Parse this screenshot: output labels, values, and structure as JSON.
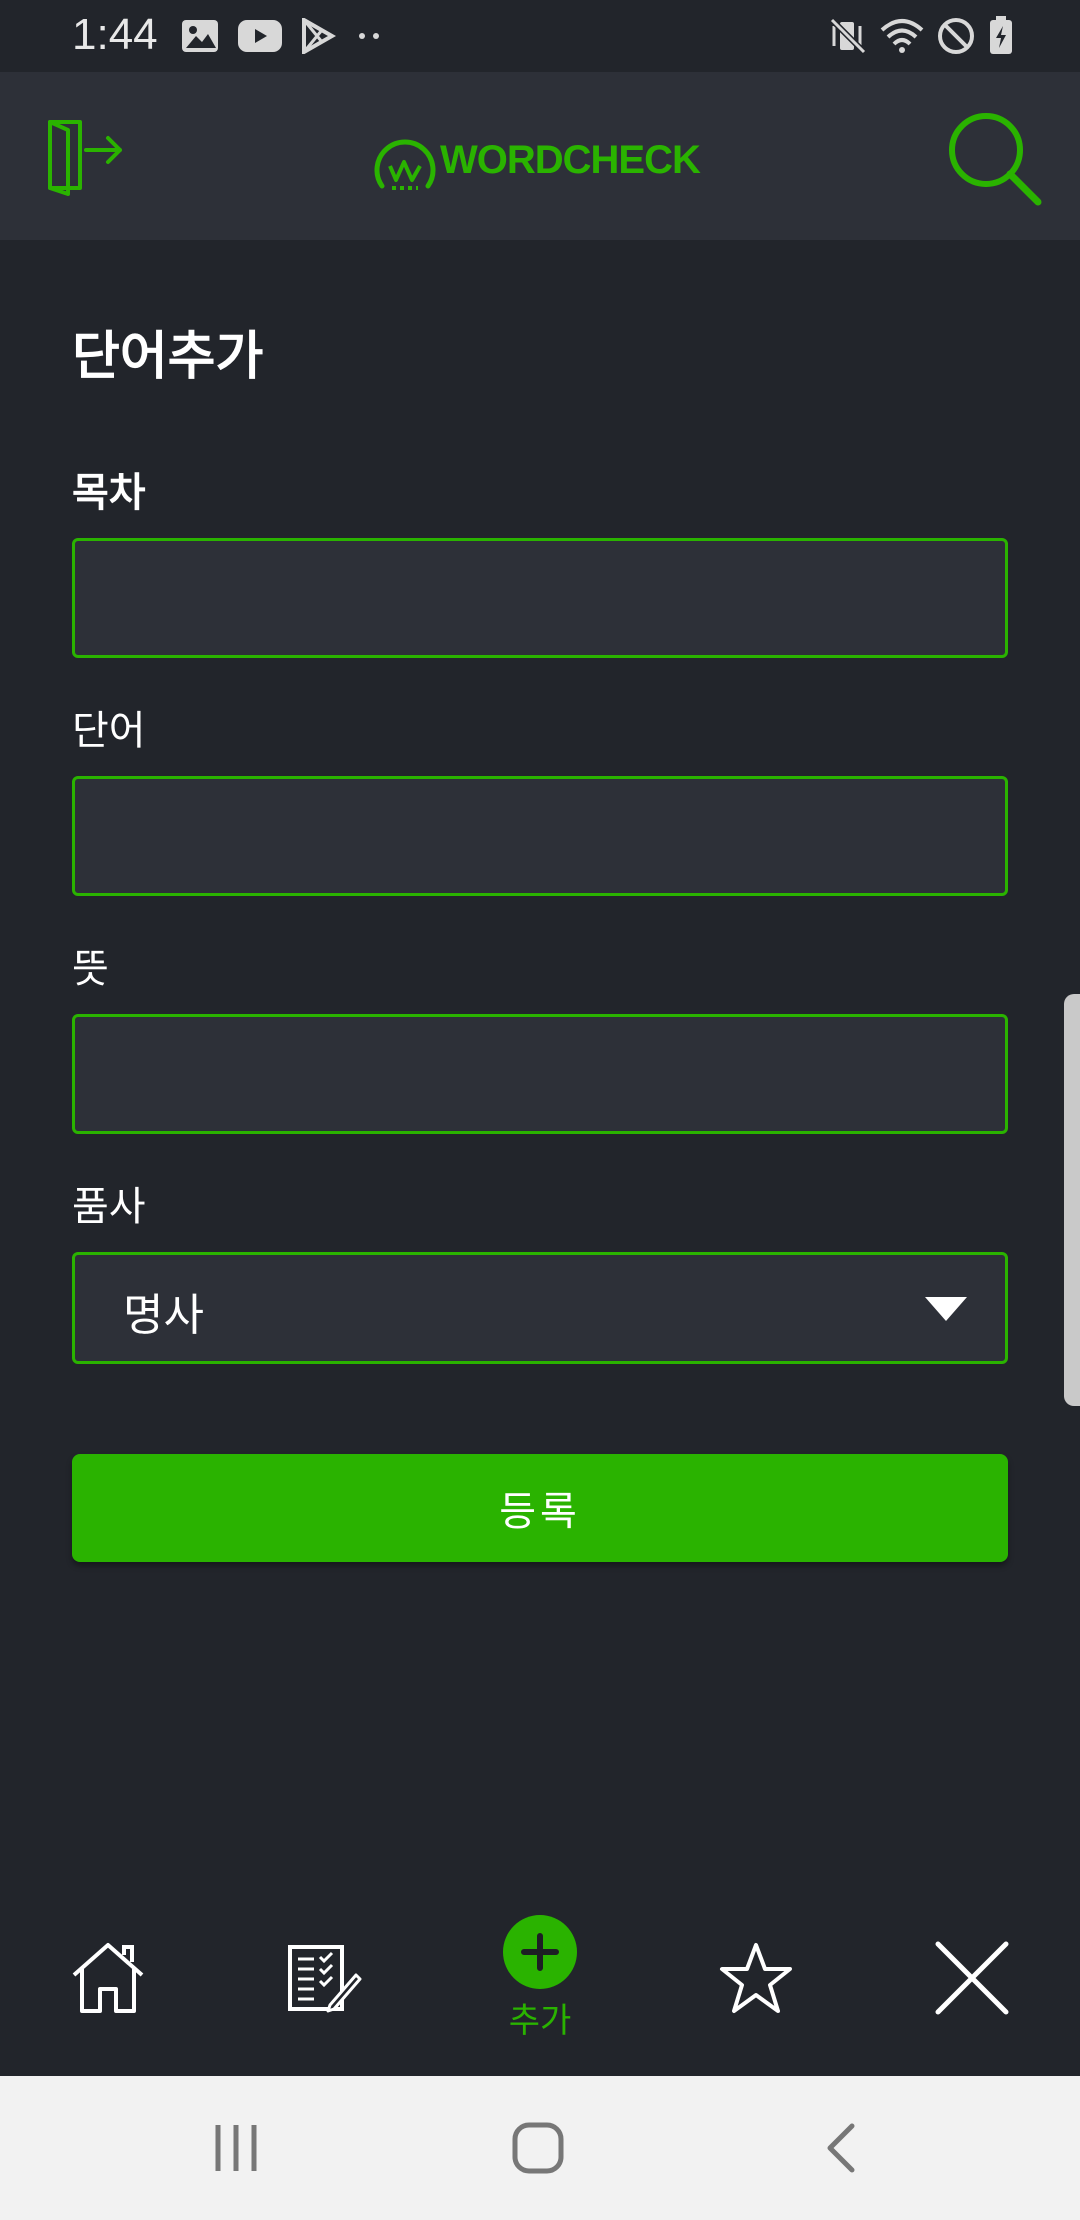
{
  "status_bar": {
    "time": "1:44",
    "left_icons": [
      "image-icon",
      "youtube-icon",
      "play-store-icon",
      "more-dots-icon"
    ],
    "right_icons": [
      "vibrate-mute-icon",
      "wifi-icon",
      "do-not-disturb-icon",
      "battery-charging-icon"
    ]
  },
  "header": {
    "logo_text": "WORDCHECK",
    "left_icon": "logout-icon",
    "right_icon": "search-icon",
    "accent": "#2ab300"
  },
  "form": {
    "title": "단어추가",
    "fields": [
      {
        "label": "목차",
        "value": ""
      },
      {
        "label": "단어",
        "value": ""
      },
      {
        "label": "뜻",
        "value": ""
      }
    ],
    "pos": {
      "label": "품사",
      "selected": "명사"
    },
    "submit_label": "등록"
  },
  "bottom_nav": {
    "items": [
      {
        "icon": "home-icon"
      },
      {
        "icon": "checklist-icon"
      },
      {
        "icon": "add-icon",
        "label": "추가",
        "active": true
      },
      {
        "icon": "star-icon"
      },
      {
        "icon": "close-icon"
      }
    ]
  },
  "system_nav": {
    "items": [
      "recent-apps-icon",
      "home-button-icon",
      "back-icon"
    ]
  }
}
